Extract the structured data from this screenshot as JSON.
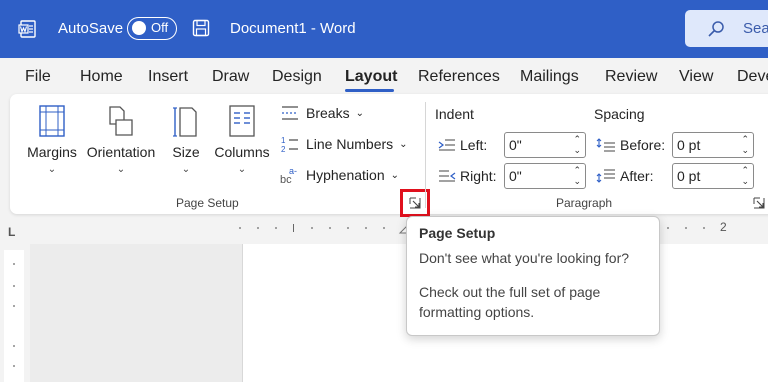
{
  "titlebar": {
    "autosave_label": "AutoSave",
    "autosave_state": "Off",
    "document_title": "Document1  -  Word",
    "search_placeholder": "Sea"
  },
  "tabs": [
    "File",
    "Home",
    "Insert",
    "Draw",
    "Design",
    "Layout",
    "References",
    "Mailings",
    "Review",
    "View",
    "Deve"
  ],
  "active_tab": "Layout",
  "page_setup": {
    "margins": "Margins",
    "orientation": "Orientation",
    "size": "Size",
    "columns": "Columns",
    "breaks": "Breaks",
    "line_numbers": "Line Numbers",
    "hyphenation": "Hyphenation",
    "group_label": "Page Setup"
  },
  "paragraph": {
    "indent_label": "Indent",
    "spacing_label": "Spacing",
    "left_label": "Left:",
    "left_value": "0\"",
    "right_label": "Right:",
    "right_value": "0\"",
    "before_label": "Before:",
    "before_value": "0 pt",
    "after_label": "After:",
    "after_value": "0 pt",
    "group_label": "Paragraph"
  },
  "ruler": {
    "mark": "2"
  },
  "tooltip": {
    "title": "Page Setup",
    "line1": "Don't see what you're looking for?",
    "line2": "Check out the full set of page formatting options."
  },
  "colors": {
    "brand": "#2f5fc6",
    "highlight": "#e0101d"
  }
}
